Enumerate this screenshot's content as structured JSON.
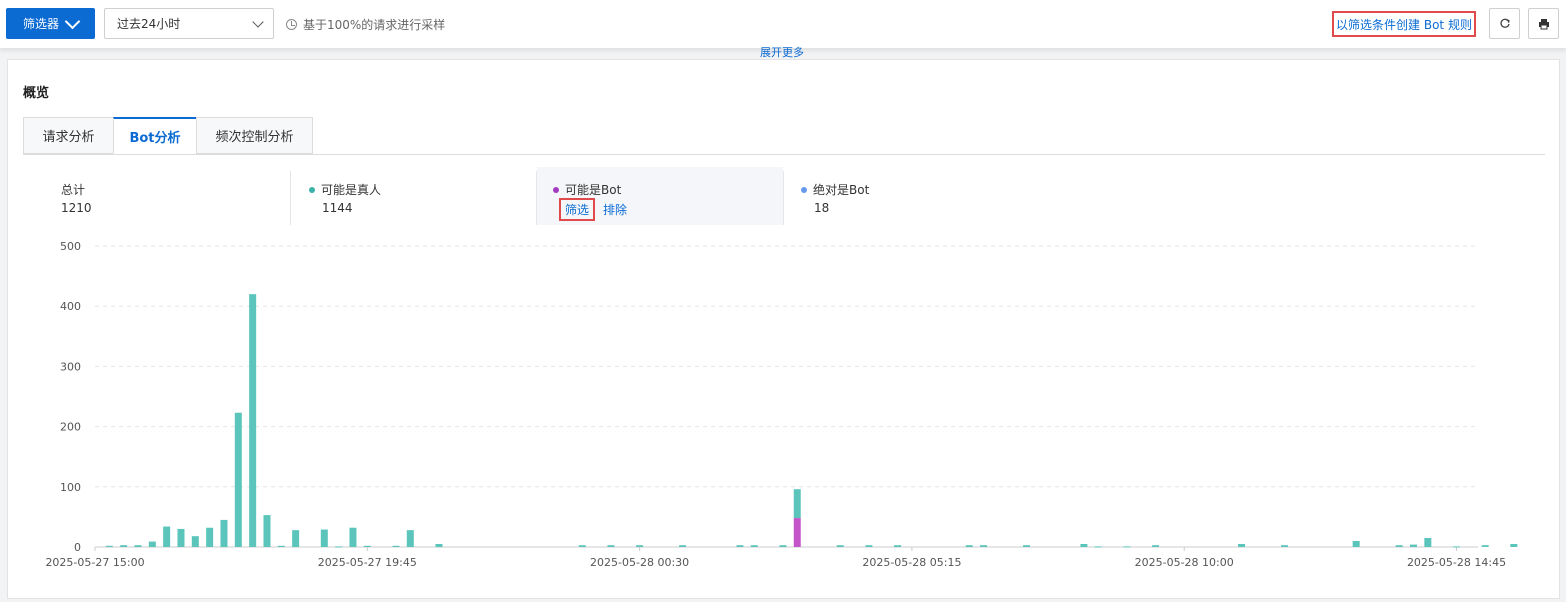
{
  "toolbar": {
    "filter_label": "筛选器",
    "time_range": "过去24小时",
    "sampling_text": "基于100%的请求进行采样",
    "create_rule_label": "以筛选条件创建 Bot 规则",
    "refresh_icon": "refresh-icon",
    "print_icon": "print-icon",
    "expand_more": "展开更多"
  },
  "overview": {
    "title": "概览",
    "tabs": [
      {
        "label": "请求分析",
        "active": false
      },
      {
        "label": "Bot分析",
        "active": true
      },
      {
        "label": "频次控制分析",
        "active": false
      }
    ],
    "stats": [
      {
        "label": "总计",
        "value": "1210",
        "dot_color": ""
      },
      {
        "label": "可能是真人",
        "value": "1144",
        "dot_color": "#3bb3a8"
      },
      {
        "label": "可能是Bot",
        "value": "",
        "dot_color": "#a23bc0",
        "actions": [
          "筛选",
          "排除"
        ]
      },
      {
        "label": "绝对是Bot",
        "value": "18",
        "dot_color": "#6699ee"
      }
    ]
  },
  "colors": {
    "accent": "#0b6bd3",
    "human": "#5bc5bb",
    "likely_bot": "#c455c9",
    "definite_bot": "#6699ee",
    "highlight_border": "#e14a4a"
  },
  "chart_data": {
    "type": "bar",
    "stacked": true,
    "grid": true,
    "ylim": [
      0,
      500
    ],
    "yticks": [
      0,
      100,
      200,
      300,
      400,
      500
    ],
    "x_tick_labels": [
      "2025-05-27 15:00",
      "2025-05-27 19:45",
      "2025-05-28 00:30",
      "2025-05-28 05:15",
      "2025-05-28 10:00",
      "2025-05-28 14:45"
    ],
    "xlim_slots": [
      0,
      96
    ],
    "series": [
      {
        "name": "可能是真人",
        "points": [
          [
            1,
            2
          ],
          [
            2,
            3
          ],
          [
            3,
            3
          ],
          [
            4,
            9
          ],
          [
            5,
            34
          ],
          [
            6,
            30
          ],
          [
            7,
            18
          ],
          [
            8,
            32
          ],
          [
            9,
            45
          ],
          [
            10,
            223
          ],
          [
            11,
            420
          ],
          [
            12,
            53
          ],
          [
            13,
            2
          ],
          [
            14,
            28
          ],
          [
            16,
            29
          ],
          [
            17,
            1
          ],
          [
            18,
            32
          ],
          [
            19,
            2
          ],
          [
            21,
            2
          ],
          [
            22,
            28
          ],
          [
            24,
            5
          ],
          [
            34,
            3
          ],
          [
            36,
            3
          ],
          [
            38,
            3
          ],
          [
            41,
            3
          ],
          [
            45,
            3
          ],
          [
            46,
            3
          ],
          [
            48,
            3
          ],
          [
            49,
            48
          ],
          [
            52,
            3
          ],
          [
            54,
            3
          ],
          [
            56,
            3
          ],
          [
            61,
            3
          ],
          [
            62,
            3
          ],
          [
            65,
            3
          ],
          [
            69,
            5
          ],
          [
            70,
            1
          ],
          [
            72,
            1
          ],
          [
            74,
            3
          ],
          [
            80,
            5
          ],
          [
            83,
            3
          ],
          [
            88,
            10
          ],
          [
            91,
            3
          ],
          [
            92,
            4
          ],
          [
            93,
            15
          ],
          [
            95,
            1
          ],
          [
            97,
            3
          ],
          [
            99,
            5
          ]
        ]
      },
      {
        "name": "可能是Bot",
        "points": [
          [
            49,
            48
          ]
        ]
      }
    ]
  }
}
